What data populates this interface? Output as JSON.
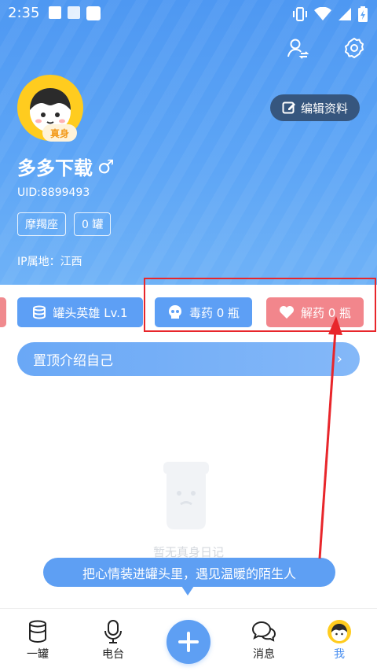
{
  "status_bar": {
    "time": "2:35"
  },
  "profile": {
    "verified_badge": "真身",
    "edit_label": "编辑资料",
    "username": "多多下载",
    "gender_symbol": "♂",
    "uid": "UID:8899493",
    "tags": [
      "摩羯座",
      "0 罐"
    ],
    "ip_location": "IP属地：江西"
  },
  "chips": {
    "hero": "罐头英雄 Lv.1",
    "poison": "毒药 0 瓶",
    "antidote": "解药 0 瓶"
  },
  "pin_intro": "置顶介绍自己",
  "empty_state": "暂无真身日记",
  "tooltip": "把心情装进罐头里，遇见温暖的陌生人",
  "bottom_nav": {
    "items": [
      {
        "label": "一罐",
        "icon": "jar-icon"
      },
      {
        "label": "电台",
        "icon": "microphone-icon"
      },
      {
        "label": "",
        "icon": "plus-icon"
      },
      {
        "label": "消息",
        "icon": "chat-bubbles-icon"
      },
      {
        "label": "我",
        "icon": "avatar-icon"
      }
    ]
  },
  "colors": {
    "header_blue": "#5ea6f6",
    "chip_blue": "#5d9ff5",
    "chip_pink": "#f2868c",
    "edit_button_dark": "#36567e",
    "active_nav": "#4a8ff0",
    "annotation_red": "#e8262b"
  }
}
